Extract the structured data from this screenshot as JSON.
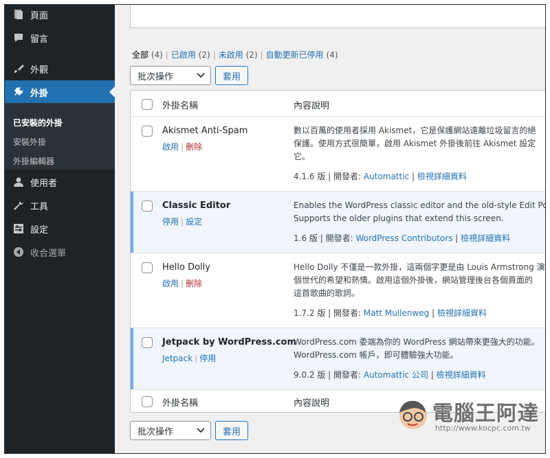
{
  "sidebar": {
    "items": [
      {
        "label": "頁面",
        "icon": "page-icon"
      },
      {
        "label": "留言",
        "icon": "comment-icon"
      },
      {
        "label": "外觀",
        "icon": "paintbrush-icon"
      },
      {
        "label": "外掛",
        "icon": "plugin-icon"
      },
      {
        "label": "使用者",
        "icon": "user-icon"
      },
      {
        "label": "工具",
        "icon": "wrench-icon"
      },
      {
        "label": "設定",
        "icon": "settings-icon"
      },
      {
        "label": "收合選單",
        "icon": "collapse-arrow-icon"
      }
    ],
    "submenu": [
      "已安裝的外掛",
      "安裝外掛",
      "外掛編輯器"
    ]
  },
  "filters": {
    "all": "全部",
    "all_count": "(4)",
    "active": "已啟用",
    "active_count": "(2)",
    "inactive": "未啟用",
    "inactive_count": "(2)",
    "autoupdate_disabled": "自動更新已停用",
    "autoupdate_count": "(4)"
  },
  "bulk": {
    "select": "批次操作",
    "apply": "套用"
  },
  "table": {
    "col_name": "外掛名稱",
    "col_desc": "內容說明",
    "plugins": [
      {
        "name": "Akismet Anti-Spam",
        "actions": [
          "啟用",
          "刪除"
        ],
        "desc": [
          "數以百萬的使用者採用 Akismet，它是保護網站遠離垃圾留言的絕",
          "保護。使用方式很簡單，啟用 Akismet 外掛後前往 Akismet 設定",
          "它。"
        ],
        "version": "4.1.6 版",
        "author_label": "開發者:",
        "author": "Automattic",
        "details": "檢視詳細資料"
      },
      {
        "name": "Classic Editor",
        "actions": [
          "停用",
          "設定"
        ],
        "desc": [
          "Enables the WordPress classic editor and the old-style Edit Post s",
          "Supports the older plugins that extend this screen."
        ],
        "version": "1.6 版",
        "author_label": "開發者:",
        "author": "WordPress Contributors",
        "details": "檢視詳細資料"
      },
      {
        "name": "Hello Dolly",
        "actions": [
          "啟用",
          "刪除"
        ],
        "desc": [
          "Hello Dolly 不僅是一款外掛，這兩個字更是由 Louis Armstrong 演",
          "個世代的希望和熱情。啟用這個外掛後，網站管理後台各個頁面的",
          "這首歌曲的歌詞。"
        ],
        "version": "1.7.2 版",
        "author_label": "開發者:",
        "author": "Matt Mullenweg",
        "details": "檢視詳細資料"
      },
      {
        "name": "Jetpack by WordPress.com",
        "actions": [
          "Jetpack",
          "停用"
        ],
        "desc": [
          "WordPress.com 委端為你的 WordPress 網站帶來更強大的功能。",
          "WordPress.com 帳戶，即可體驗強大功能。"
        ],
        "version": "9.0.2 版",
        "author_label": "開發者:",
        "author": "Automattic 公司",
        "details": "檢視詳細資料"
      }
    ]
  },
  "watermark": {
    "title": "電腦王阿達",
    "url": "http://www.kocpc.com.tw"
  }
}
